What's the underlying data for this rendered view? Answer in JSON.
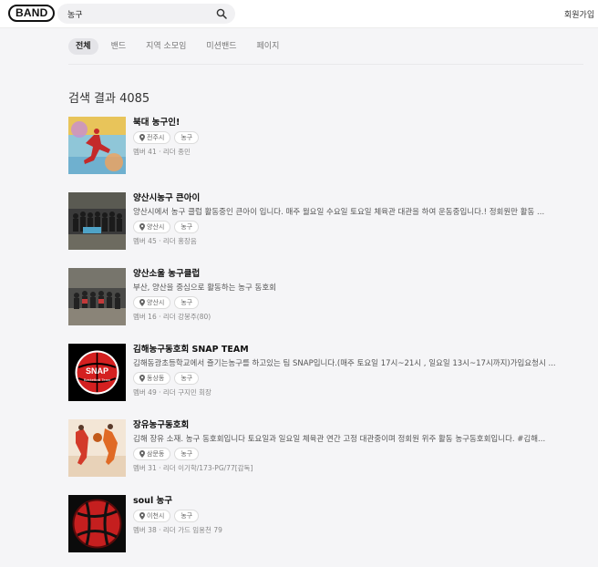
{
  "header": {
    "logo": "BAND",
    "search_value": "농구",
    "signup_label": "회원가입"
  },
  "tabs": [
    "전체",
    "밴드",
    "지역 소모임",
    "미션밴드",
    "페이지"
  ],
  "results_title": "검색 결과 4085",
  "results": [
    {
      "name": "북대 농구인!",
      "description": "",
      "location": "전주시",
      "tag": "농구",
      "meta": "멤버 41 · 리더 종민"
    },
    {
      "name": "양산시농구 큰아이",
      "description": "양산시에서 농구 클럽 활동중인 큰아이 입니다. 매주 월요일 수요일 토요일 체육관 대관을 하여 운동중입니다.! 정회원만 활동 ...",
      "location": "양산시",
      "tag": "농구",
      "meta": "멤버 45 · 리더 홍장음"
    },
    {
      "name": "양산소울 농구클럽",
      "description": "부산, 양산을 중심으로 활동하는 농구 동호회",
      "location": "양산시",
      "tag": "농구",
      "meta": "멤버 16 · 리더 강봉주(80)"
    },
    {
      "name": "김해농구동호회 SNAP TEAM",
      "description": "김해동광초등학교에서 즐기는농구를 하고있는 팀 SNAP입니다.(매주 토요일 17시~21시 , 일요일 13시~17시까지)가입요청시 ...",
      "location": "동상동",
      "tag": "농구",
      "meta": "멤버 49 · 리더 구지민 회장"
    },
    {
      "name": "장유농구동호회",
      "description": "김해 장유 소재. 농구 동호회입니다 토요일과 일요일 체육관 연간 고정 대관중이며 정회원 위주 활동 농구동호회입니다. #김해...",
      "location": "삼문동",
      "tag": "농구",
      "meta": "멤버 31 · 리더 이기학/173-PG/77[감독]"
    },
    {
      "name": "soul 농구",
      "description": "",
      "location": "이천시",
      "tag": "농구",
      "meta": "멤버 38 · 리더 가드 임용천 79"
    }
  ],
  "thumb_labels": {
    "snap_top": "SNAP",
    "snap_mid": "Basketball Team"
  },
  "colors": {
    "accent_active_tab": "#e4e4e8",
    "background": "#f5f5f7"
  }
}
